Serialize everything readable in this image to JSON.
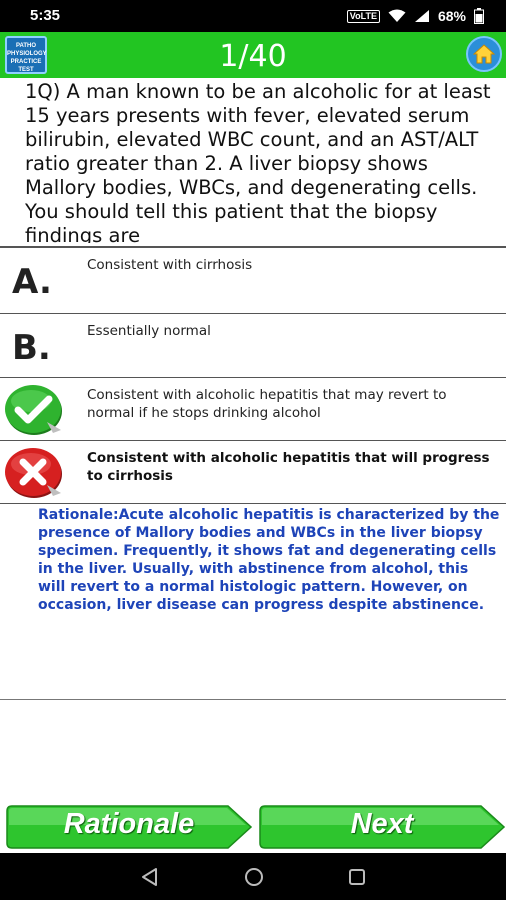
{
  "status_bar": {
    "time": "5:35",
    "network": "VoLTE",
    "battery": "68%"
  },
  "header": {
    "logo_text": "PATHO PHYSIOLOGY PRACTICE TEST",
    "counter": "1/40"
  },
  "question": {
    "text": "1Q) A man known to be an alcoholic for at least 15 years presents with fever, elevated serum bilirubin, elevated WBC count, and an AST/ALT ratio greater than 2. A liver biopsy shows Mallory bodies, WBCs, and degenerating cells. You should tell this patient that the biopsy findings are"
  },
  "options": [
    {
      "marker": "A.",
      "text": "Consistent with cirrhosis"
    },
    {
      "marker": "B.",
      "text": "Essentially normal"
    },
    {
      "marker": "correct",
      "text": "Consistent with alcoholic hepatitis that may revert to normal if he stops drinking alcohol"
    },
    {
      "marker": "wrong",
      "text": "Consistent with alcoholic hepatitis that will progress to cirrhosis"
    }
  ],
  "rationale": {
    "text": "Rationale:Acute alcoholic hepatitis is characterized by the presence of Mallory bodies and WBCs in the liver biopsy specimen. Frequently, it shows fat and degenerating cells in the liver. Usually, with abstinence from alcohol, this will revert to a normal histologic pattern. However, on occasion, liver disease can progress despite abstinence."
  },
  "buttons": {
    "rationale_label": "Rationale",
    "next_label": "Next"
  },
  "icons": {
    "correct": "check-icon",
    "wrong": "cross-icon",
    "home": "home-icon"
  },
  "colors": {
    "appbar": "#22c522",
    "button": "#2ec52e",
    "rationale_text": "#1e44b8"
  }
}
